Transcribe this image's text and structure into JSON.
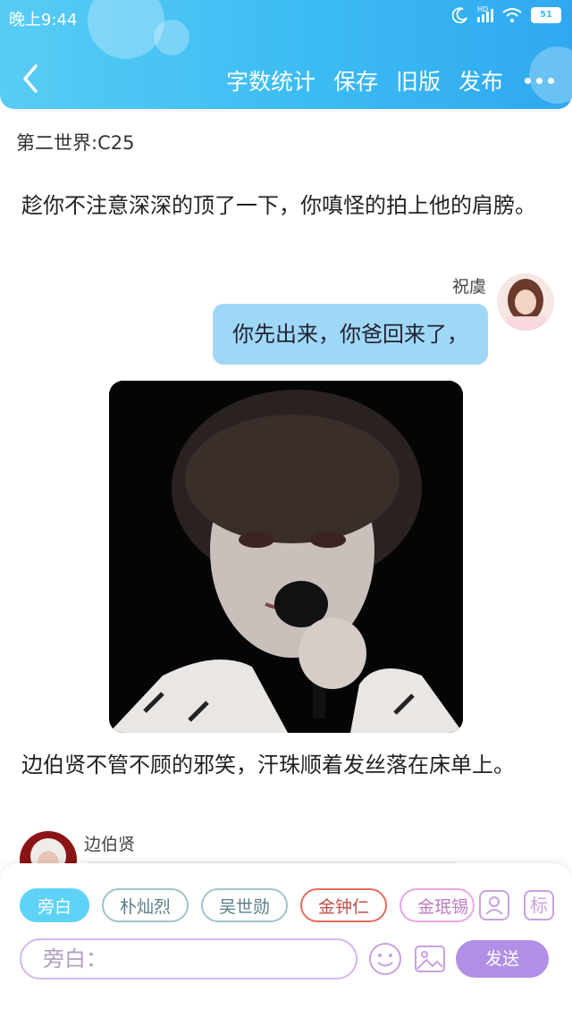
{
  "status_bar": {
    "time": "晚上9:44",
    "network": "HD",
    "battery": "51"
  },
  "toolbar": {
    "word_count": "字数统计",
    "save": "保存",
    "old_version": "旧版",
    "publish": "发布"
  },
  "chapter_title": "第二世界:C25",
  "messages": [
    {
      "type": "narration",
      "text": "趁你不注意深深的顶了一下，你嗔怪的拍上他的肩膀。"
    },
    {
      "type": "speech",
      "speaker": "祝虞",
      "side": "right",
      "text": "你先出来，你爸回来了，"
    },
    {
      "type": "image",
      "alt": "photo"
    },
    {
      "type": "narration",
      "text": "边伯贤不管不顾的邪笑，汗珠顺着发丝落在床单上。"
    },
    {
      "type": "speech",
      "speaker": "边伯贤",
      "side": "left",
      "text": ""
    }
  ],
  "composer": {
    "roles": [
      "旁白",
      "朴灿烈",
      "吴世勋",
      "金钟仁",
      "金珉锡"
    ],
    "active_role": "旁白",
    "role_icon_label": "标",
    "placeholder": "旁白：",
    "send_label": "发送"
  },
  "colors": {
    "header": "#3ebdf3",
    "bubble_right": "#9fd8f7",
    "send": "#b28fe6",
    "chip_active": "#5fd3f7"
  }
}
